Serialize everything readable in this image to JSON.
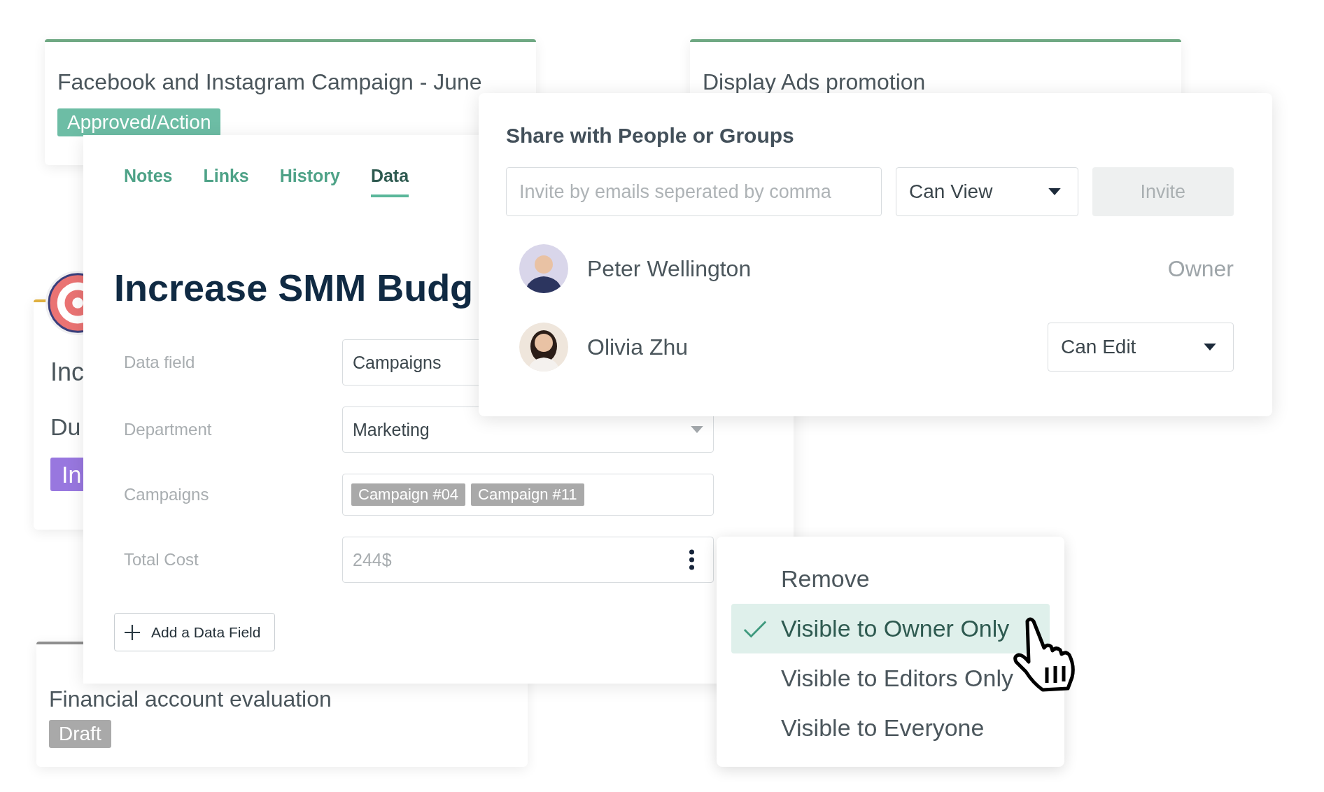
{
  "cards": [
    {
      "title": "Facebook and Instagram Campaign - June",
      "color": "#6fa883",
      "status": {
        "text": "Approved/Action",
        "color": "#6dbda5"
      }
    },
    {
      "title": "Display Ads promotion",
      "color": "#6fa883"
    },
    {
      "title": "Inc",
      "subtitle": "Du",
      "color": "#e0b040",
      "status": {
        "text": "In",
        "color": "#9877df"
      }
    },
    {
      "title": "Financial account evaluation",
      "color": "#8f8f8f",
      "status": {
        "text": "Draft",
        "color": "#a9a9a9"
      }
    }
  ],
  "detail": {
    "tabs": [
      {
        "label": "Notes",
        "selected": false
      },
      {
        "label": "Links",
        "selected": false
      },
      {
        "label": "History",
        "selected": false
      },
      {
        "label": "Data",
        "selected": true
      }
    ],
    "title": "Increase SMM Budg",
    "fields": [
      {
        "label": "Data field",
        "kind": "text",
        "value": "Campaigns"
      },
      {
        "label": "Department",
        "kind": "select",
        "value": "Marketing"
      },
      {
        "label": "Campaigns",
        "kind": "tags",
        "tags": [
          "Campaign #04",
          "Campaign #11"
        ]
      },
      {
        "label": "Total Cost",
        "kind": "menu",
        "placeholder": "244$"
      }
    ],
    "add_button": "Add a Data Field"
  },
  "share": {
    "title": "Share with People or Groups",
    "invite_field": {
      "placeholder": "Invite by emails seperated by comma"
    },
    "permission": "Can View",
    "invite_button": {
      "label": "Invite",
      "disabled": true
    },
    "people": [
      {
        "name": "Peter Wellington",
        "kind": "role",
        "role": "Owner"
      },
      {
        "name": "Olivia Zhu",
        "kind": "select",
        "role": "Can Edit"
      }
    ]
  },
  "share_menu": {
    "items": [
      {
        "label": "Remove",
        "selected": false
      },
      {
        "label": "Visible to Owner Only",
        "selected": true
      },
      {
        "label": "Visible to Editors Only",
        "selected": false
      },
      {
        "label": "Visible to Everyone",
        "selected": false
      }
    ]
  }
}
